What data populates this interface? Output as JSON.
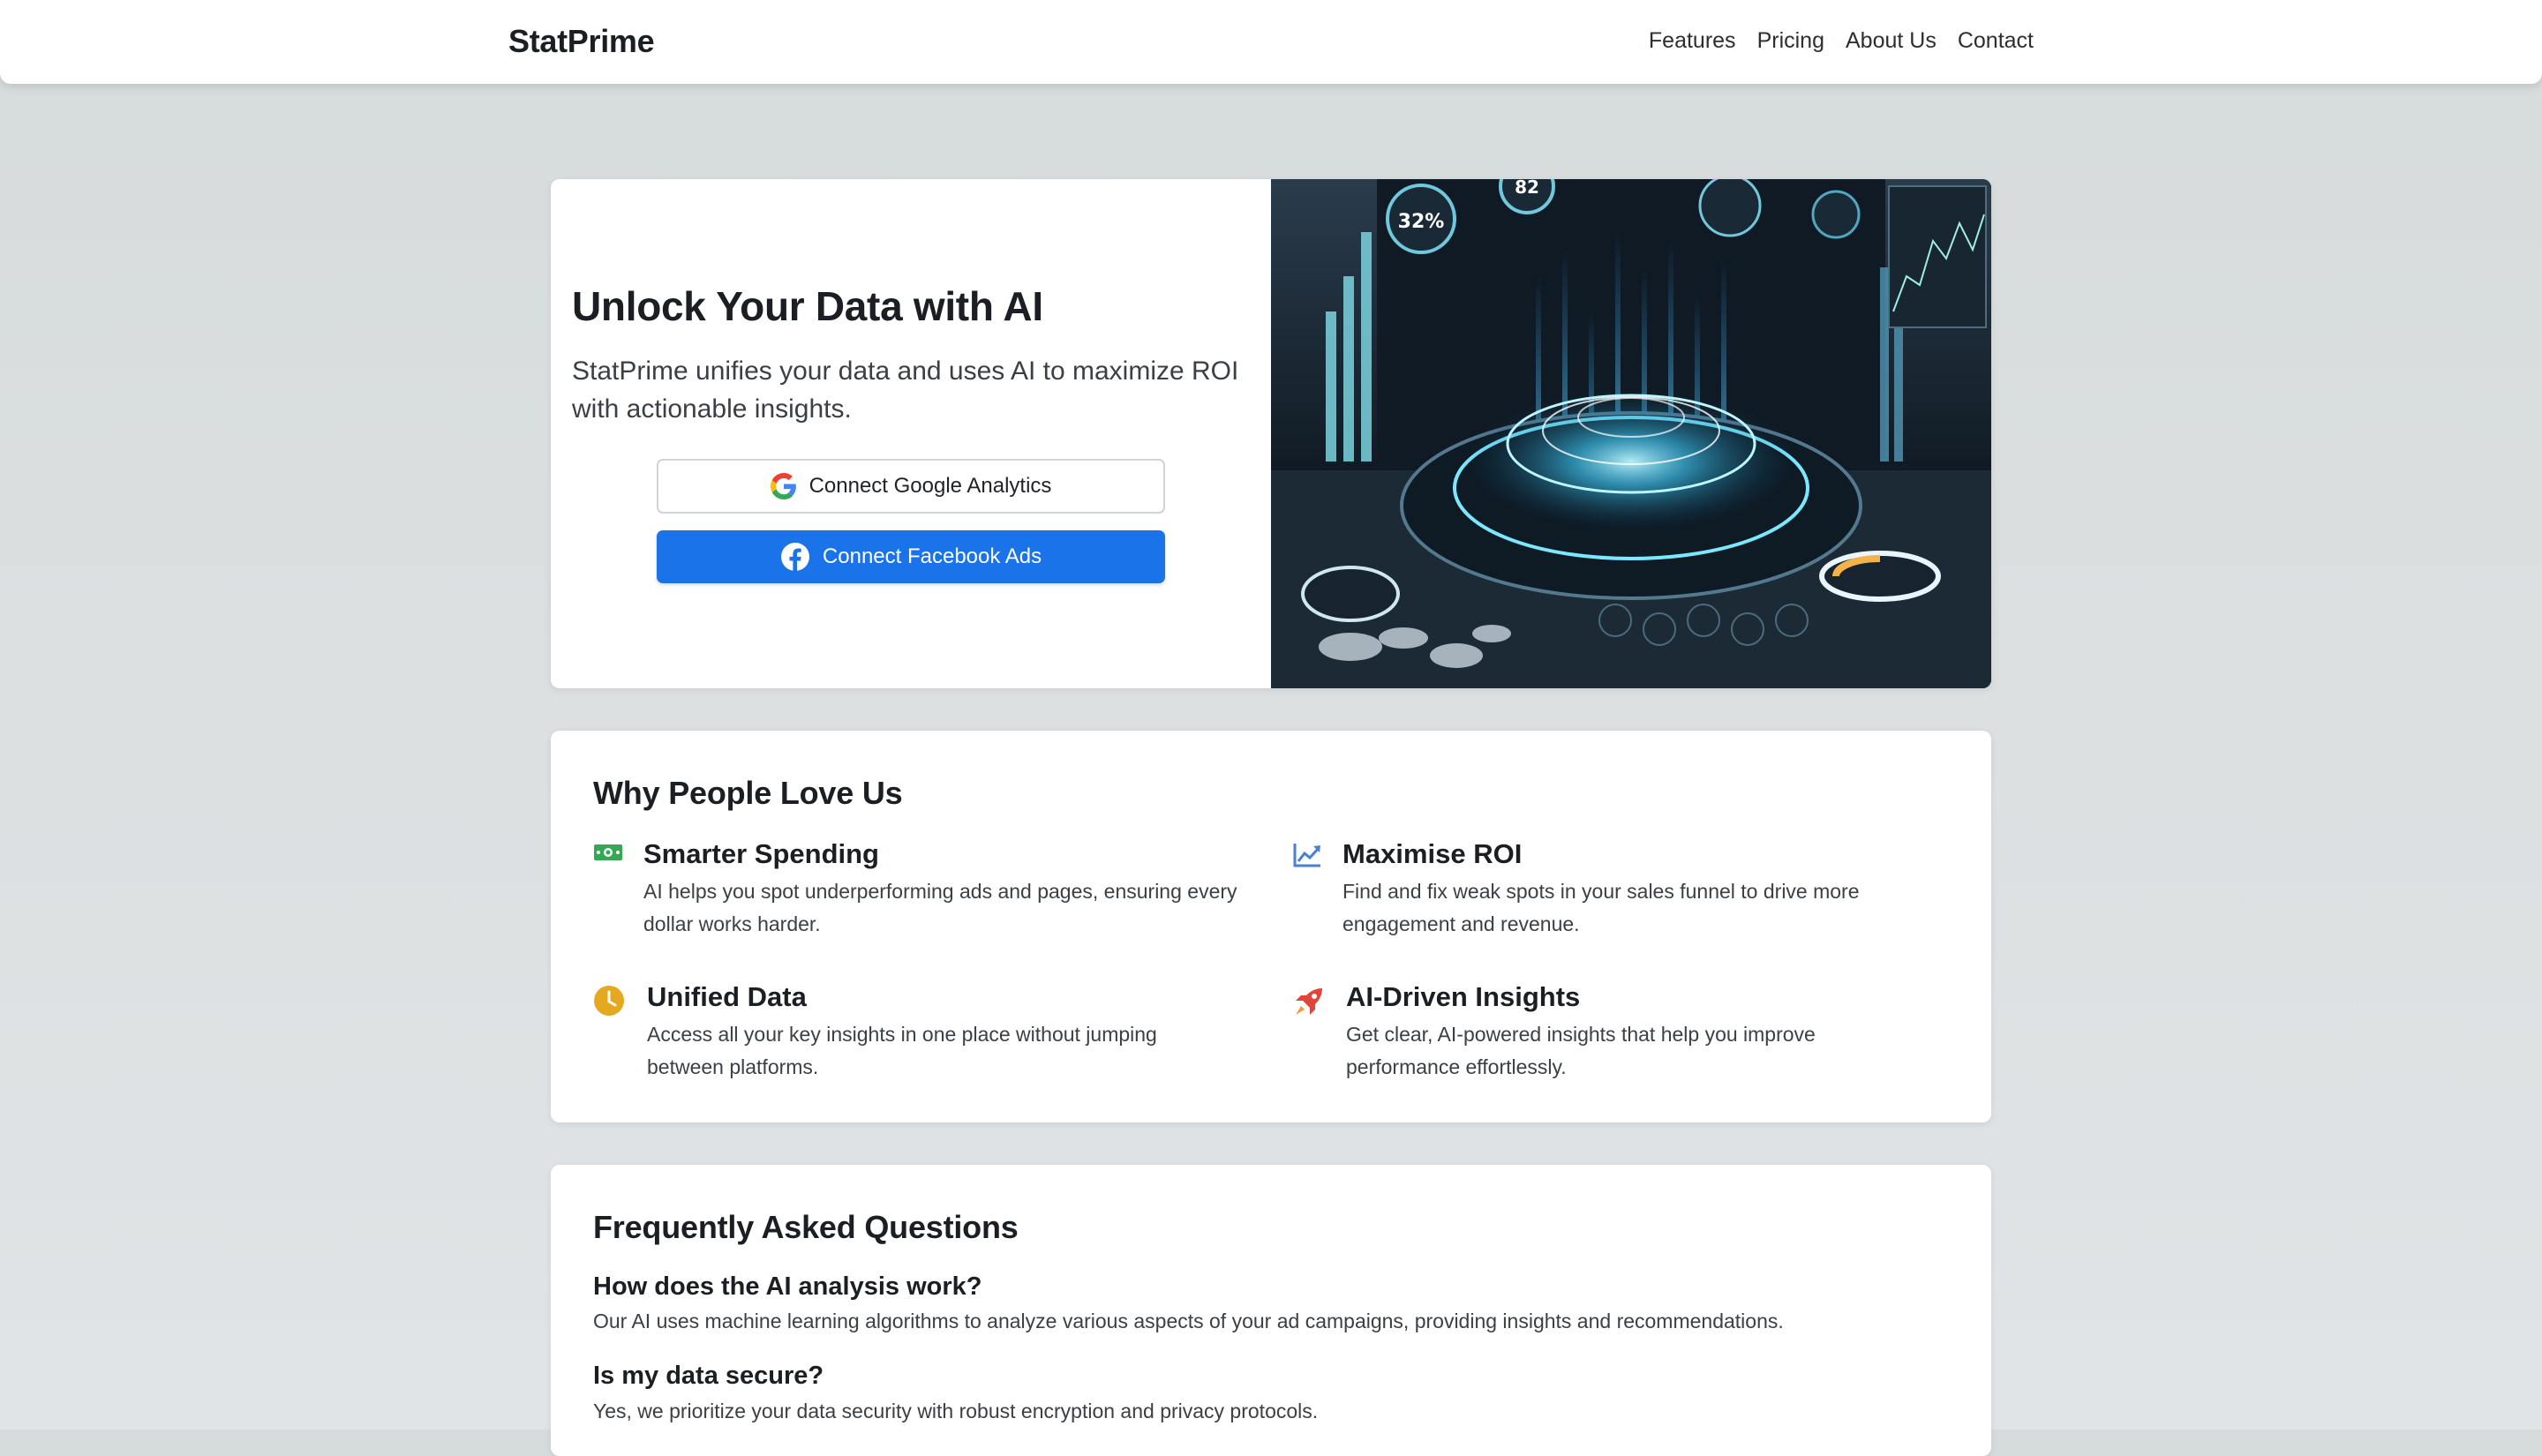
{
  "navbar": {
    "brand": "StatPrime",
    "links": [
      "Features",
      "Pricing",
      "About Us",
      "Contact"
    ]
  },
  "hero": {
    "title": "Unlock Your Data with AI",
    "subtitle": "StatPrime unifies your data and uses AI to maximize ROI with actionable insights.",
    "google_button": "Connect Google Analytics",
    "facebook_button": "Connect Facebook Ads",
    "image_labels": [
      "32%",
      "82"
    ]
  },
  "features": {
    "title": "Why People Love Us",
    "items": [
      {
        "icon": "money-icon",
        "title": "Smarter Spending",
        "desc": "AI helps you spot underperforming ads and pages, ensuring every dollar works harder."
      },
      {
        "icon": "chart-line-icon",
        "title": "Maximise ROI",
        "desc": "Find and fix weak spots in your sales funnel to drive more engagement and revenue."
      },
      {
        "icon": "clock-icon",
        "title": "Unified Data",
        "desc": "Access all your key insights in one place without jumping between platforms."
      },
      {
        "icon": "rocket-icon",
        "title": "AI-Driven Insights",
        "desc": "Get clear, AI-powered insights that help you improve performance effortlessly."
      }
    ]
  },
  "faq": {
    "title": "Frequently Asked Questions",
    "items": [
      {
        "q": "How does the AI analysis work?",
        "a": "Our AI uses machine learning algorithms to analyze various aspects of your ad campaigns, providing insights and recommendations."
      },
      {
        "q": "Is my data secure?",
        "a": "Yes, we prioritize your data security with robust encryption and privacy protocols."
      }
    ]
  },
  "colors": {
    "accent": "#1a73e8",
    "money": "#34a853",
    "chart": "#4a7fd6",
    "clock": "#e5a91f",
    "rocket": "#e0453a"
  }
}
